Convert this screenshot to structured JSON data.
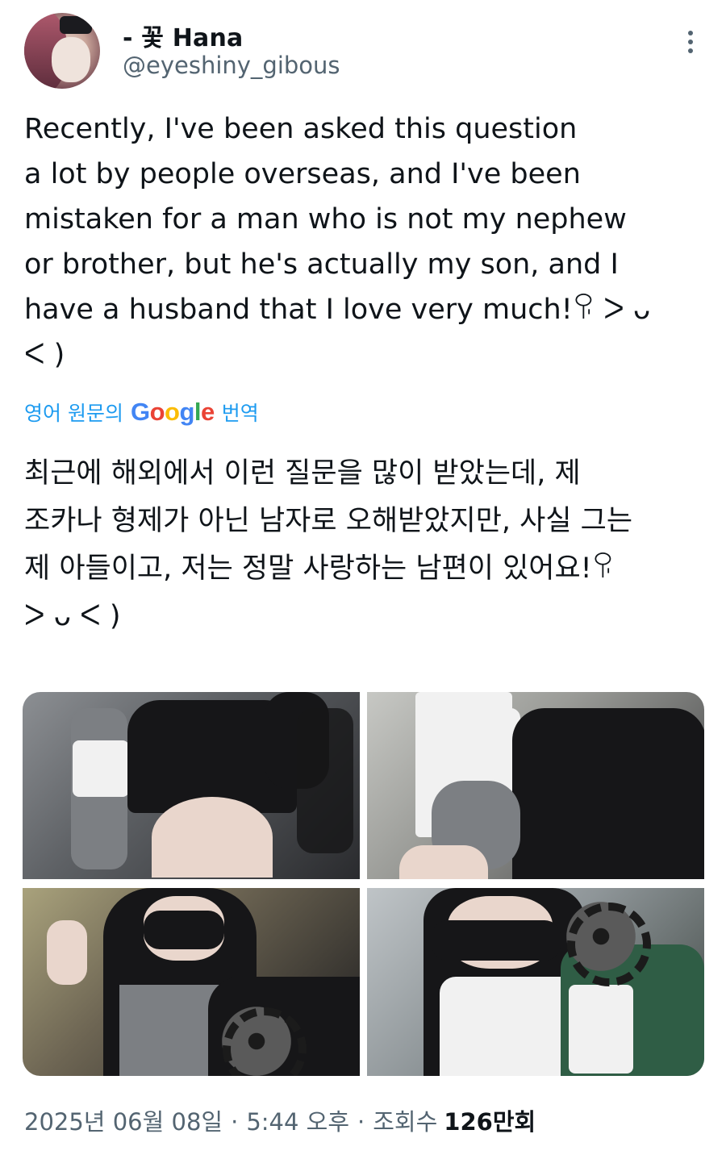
{
  "author": {
    "name": "- 꽃 Hana",
    "handle": "@eyeshiny_gibous"
  },
  "tweet": {
    "text": "Recently, I've been asked this question\na lot by people overseas, and I've been\nmistaken for a man who is not my nephew\nor brother, but he's actually my son, and I\nhave a husband that I love very much!ꀬ ᐳ ᴗ\nᐸ )",
    "translate_prefix": "영어 원문의",
    "translate_suffix": "번역",
    "translated_text": "최근에 해외에서 이런 질문을 많이 받았는데, 제\n조카나 형제가 아닌 남자로 오해받았지만, 사실 그는\n제 아들이고, 저는 정말 사랑하는 남편이 있어요!ꀬ\nᐳ ᴗ ᐸ )"
  },
  "google_logo": {
    "G": "G",
    "o1": "o",
    "o2": "o",
    "g": "g",
    "l": "l",
    "e": "e"
  },
  "footer": {
    "date": "2025년 06월 08일",
    "time": "5:44 오후",
    "views_label": "조회수",
    "views_count": "126",
    "views_unit": "만회"
  },
  "colors": {
    "link": "#1d9bf0",
    "secondary_text": "#536471",
    "primary_text": "#0f1419"
  },
  "icons": [
    "more-vertical-icon"
  ]
}
